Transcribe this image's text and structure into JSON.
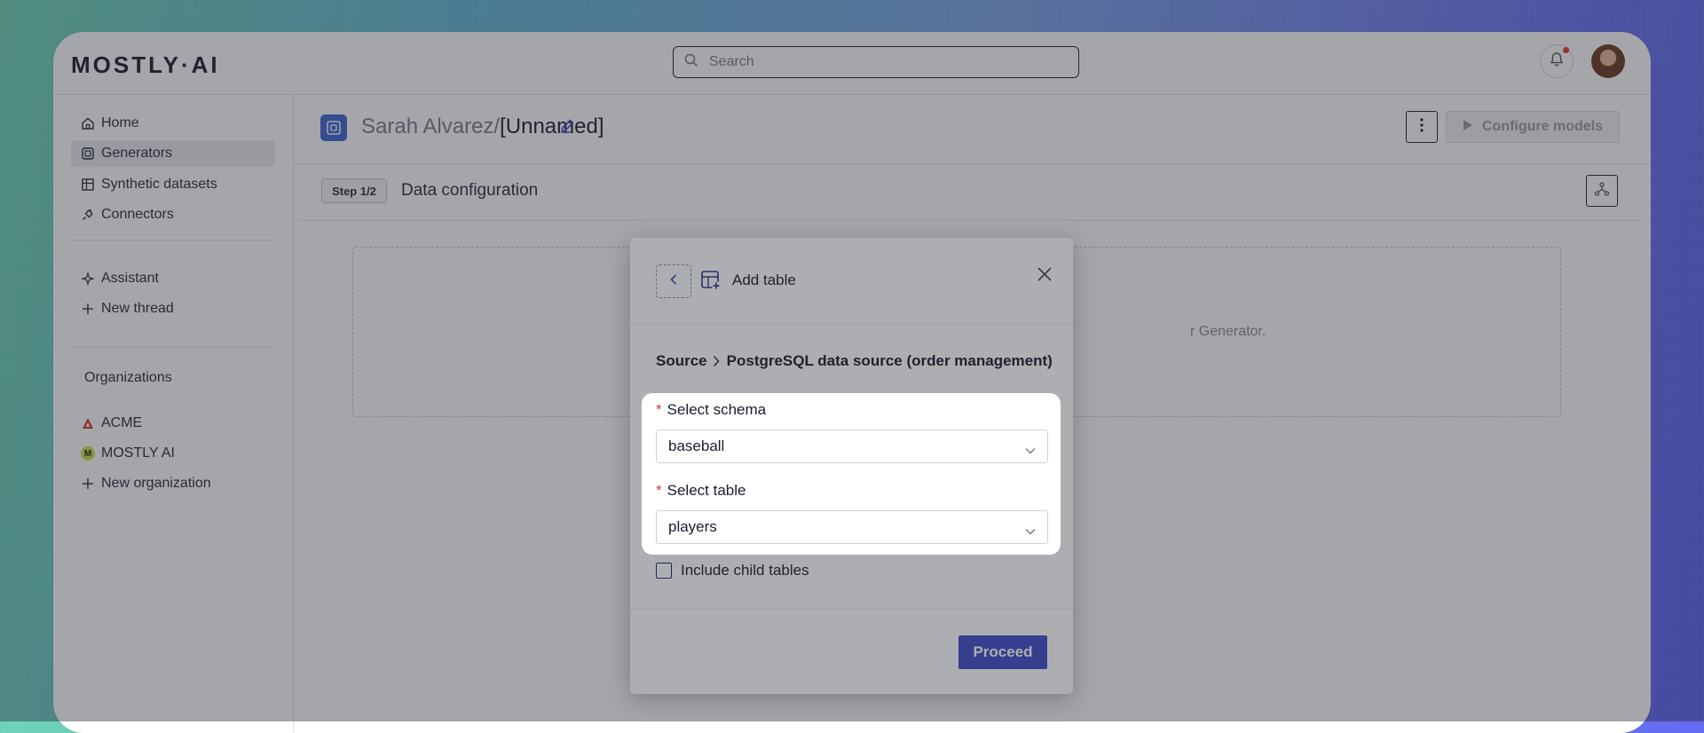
{
  "app": {
    "logo": "MOSTLY·AI",
    "search": {
      "placeholder": "Search"
    }
  },
  "sidebar": {
    "items": [
      {
        "label": "Home",
        "icon": "home-icon"
      },
      {
        "label": "Generators",
        "icon": "generator-icon",
        "active": true
      },
      {
        "label": "Synthetic datasets",
        "icon": "table-icon"
      },
      {
        "label": "Connectors",
        "icon": "plug-icon"
      }
    ],
    "assistant": {
      "label": "Assistant",
      "icon": "sparkle-icon"
    },
    "new_thread": {
      "label": "New thread",
      "icon": "plus-icon"
    },
    "organizations_title": "Organizations",
    "orgs": [
      {
        "label": "ACME",
        "badge": "A",
        "color": "#d2362c"
      },
      {
        "label": "MOSTLY AI",
        "badge": "M",
        "color": "#c9e34a"
      }
    ],
    "new_org": {
      "label": "New organization",
      "icon": "plus-icon"
    }
  },
  "header": {
    "owner": "Sarah Alvarez/",
    "name": "[Unnamed]",
    "configure_button": "Configure models"
  },
  "step": {
    "badge": "Step 1/2",
    "title": "Data configuration",
    "dropzone_text": "r Generator."
  },
  "modal": {
    "title": "Add table",
    "source_label": "Source",
    "source_value": "PostgreSQL data source (order management)",
    "schema": {
      "label": "Select schema",
      "value": "baseball"
    },
    "table": {
      "label": "Select table",
      "value": "players"
    },
    "include_child_tables": {
      "label": "Include child tables",
      "checked": false
    },
    "proceed_button": "Proceed"
  },
  "colors": {
    "accent": "#3f4dc8",
    "required": "#d83a3a",
    "notification_dot": "#e23a3a",
    "generator_icon_bg": "#3c66d6"
  }
}
